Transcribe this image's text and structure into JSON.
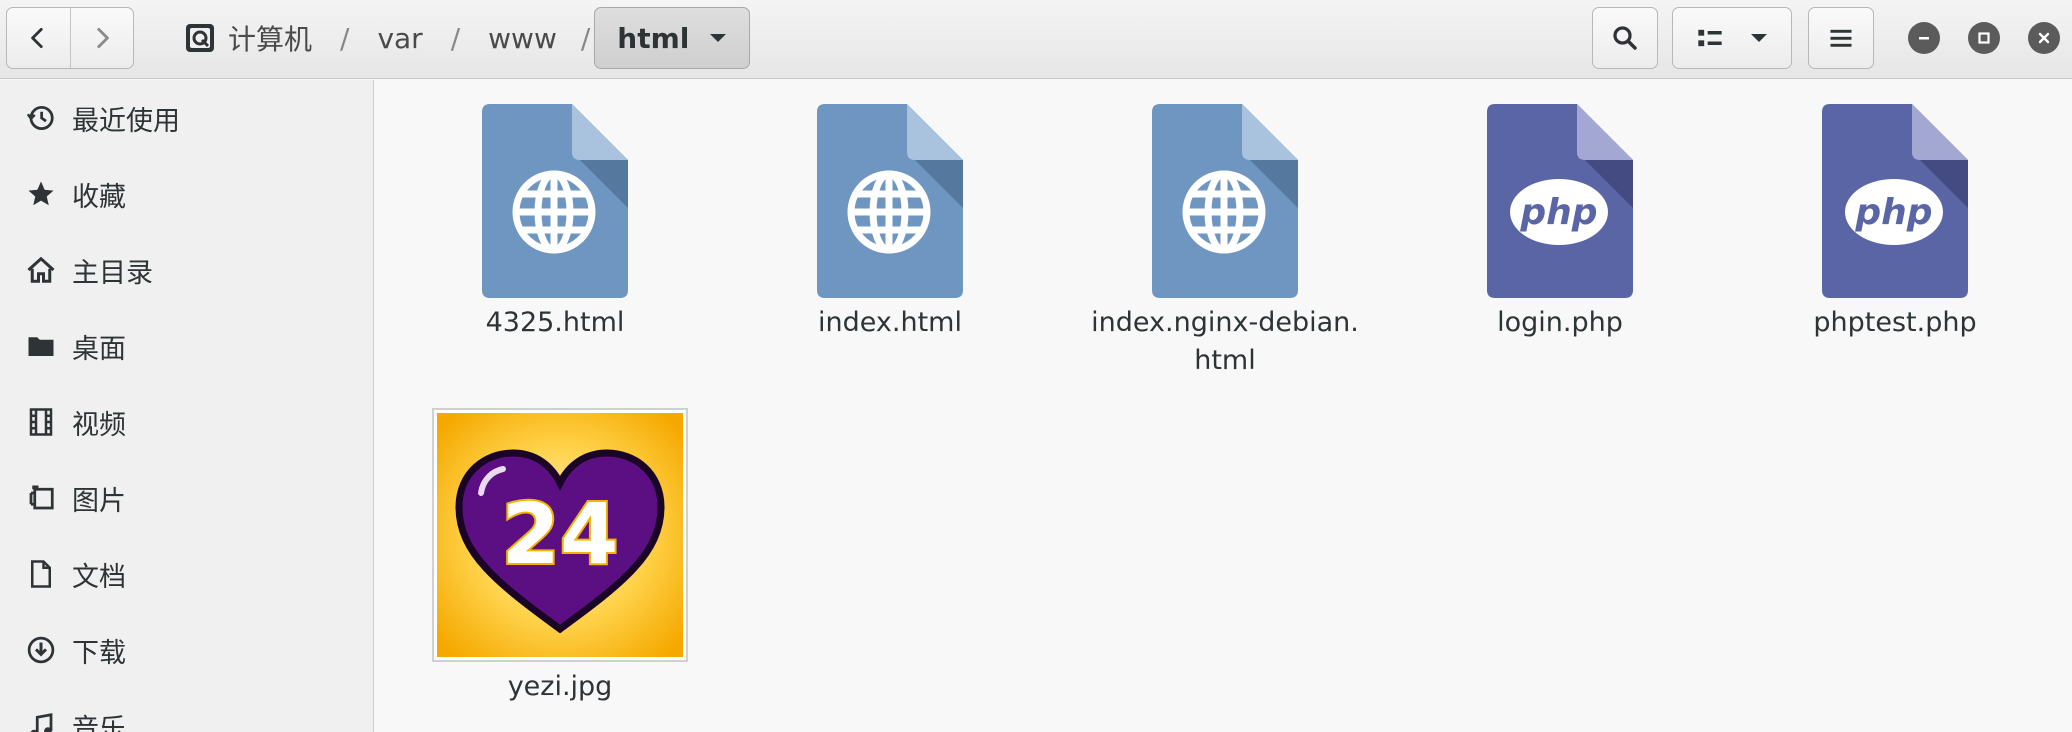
{
  "header": {
    "breadcrumbs": [
      {
        "label": "计算机"
      },
      {
        "label": "var"
      },
      {
        "label": "www"
      }
    ],
    "current_folder": "html",
    "separator": "/"
  },
  "sidebar": {
    "items": [
      {
        "label": "最近使用",
        "icon": "recent-icon"
      },
      {
        "label": "收藏",
        "icon": "star-icon"
      },
      {
        "label": "主目录",
        "icon": "home-icon"
      },
      {
        "label": "桌面",
        "icon": "desktop-folder-icon"
      },
      {
        "label": "视频",
        "icon": "video-icon"
      },
      {
        "label": "图片",
        "icon": "pictures-icon"
      },
      {
        "label": "文档",
        "icon": "document-icon"
      },
      {
        "label": "下载",
        "icon": "download-icon"
      },
      {
        "label": "音乐",
        "icon": "music-icon"
      }
    ]
  },
  "files": [
    {
      "name": "4325.html",
      "type": "html"
    },
    {
      "name": "index.html",
      "type": "html"
    },
    {
      "name": "index.nginx-debian.html",
      "type": "html"
    },
    {
      "name": "login.php",
      "type": "php"
    },
    {
      "name": "phptest.php",
      "type": "php"
    },
    {
      "name": "yezi.jpg",
      "type": "image"
    }
  ],
  "icons": {
    "php_text": "php",
    "image_text": "24"
  },
  "colors": {
    "html_file": "#6e96c1",
    "php_file": "#5a65a6",
    "image_bg": "#f9b414",
    "heart": "#5c0f82"
  }
}
